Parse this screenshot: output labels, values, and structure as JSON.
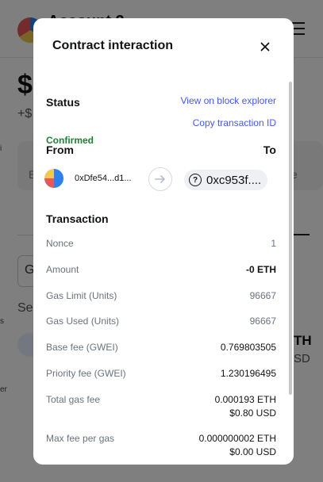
{
  "background": {
    "account_name": "Account 2",
    "balance": "$",
    "delta": "+$",
    "b1": "B",
    "e1": "e",
    "input_label": "G",
    "se_label": "Se",
    "eth_frag": "TH",
    "usd_frag": "SD",
    "edge_marks": [
      "i",
      "s",
      "er"
    ]
  },
  "modal": {
    "title": "Contract interaction",
    "status": {
      "label": "Status",
      "value": "Confirmed",
      "explorer_link": "View on block explorer",
      "copy_link": "Copy transaction ID"
    },
    "from_label": "From",
    "to_label": "To",
    "from_address": "0xDfe54...d1...",
    "to_address": "0xc953f....",
    "transaction": {
      "label": "Transaction",
      "rows": [
        {
          "label": "Nonce",
          "value": "1"
        },
        {
          "label": "Amount",
          "value": "-0 ETH"
        },
        {
          "label": "Gas Limit (Units)",
          "value": "96667"
        },
        {
          "label": "Gas Used (Units)",
          "value": "96667"
        },
        {
          "label": "Base fee (GWEI)",
          "value": "0.769803505"
        },
        {
          "label": "Priority fee (GWEI)",
          "value": "1.230196495"
        },
        {
          "label": "Total gas fee",
          "value": "0.000193 ETH",
          "value2": "$0.80 USD"
        },
        {
          "label": "Max fee per gas",
          "value": "0.000000002 ETH",
          "value2": "$0.00 USD"
        }
      ]
    }
  },
  "colors": {
    "accent": "#4459ff",
    "confirmed": "#1c8234",
    "overlay": "rgba(0,0,0,0.5)"
  }
}
